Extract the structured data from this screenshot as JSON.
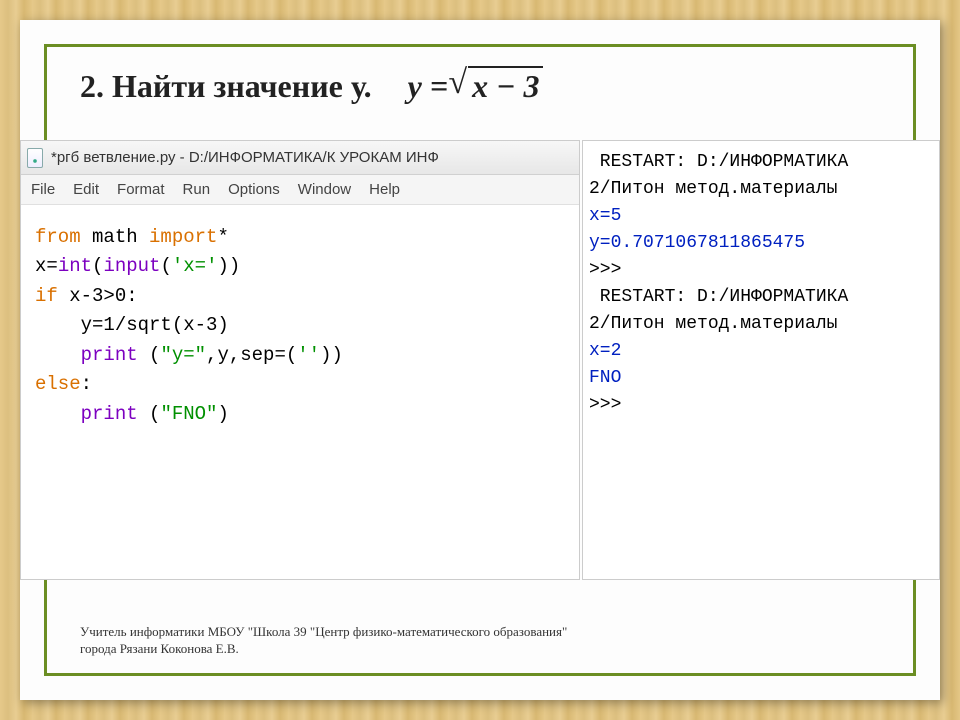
{
  "heading": {
    "number": "2.",
    "text": "Найти значение у.",
    "formula_lhs": "y  =",
    "formula_root": "x − 3"
  },
  "ide": {
    "title": "*ргб ветвление.ру - D:/ИНФОРМАТИКА/К УРОКАМ ИНФ",
    "menu": [
      "File",
      "Edit",
      "Format",
      "Run",
      "Options",
      "Window",
      "Help"
    ],
    "code": {
      "l1_from": "from",
      "l1_math": "math",
      "l1_import": "import",
      "l1_star": "*",
      "l2_a": "x=",
      "l2_b": "int",
      "l2_c": "(",
      "l2_d": "input",
      "l2_e": "(",
      "l2_f": "'x='",
      "l2_g": "))",
      "l3_a": "if",
      "l3_b": " x-3>0:",
      "l4": "    y=1/sqrt(x-3)",
      "l5_a": "    ",
      "l5_b": "print",
      "l5_c": " (",
      "l5_d": "\"y=\"",
      "l5_e": ",y,sep=(",
      "l5_f": "''",
      "l5_g": "))",
      "l6_a": "else",
      "l6_b": ":",
      "l7_a": "    ",
      "l7_b": "print",
      "l7_c": " (",
      "l7_d": "\"FNO\"",
      "l7_e": ")"
    }
  },
  "shell": {
    "r1": " RESTART: D:/ИНФОРМАТИКА",
    "r2": "2/Питон метод.материалы",
    "x1": "x=5",
    "y1": "y=0.7071067811865475",
    "p1": ">>>",
    "r3": " RESTART: D:/ИНФОРМАТИКА",
    "r4": "2/Питон метод.материалы",
    "x2": "x=2",
    "fno": "FNO",
    "p2": ">>>"
  },
  "footer": {
    "line1": "Учитель информатики МБОУ \"Школа 39 \"Центр физико-математического образования\"",
    "line2": "города Рязани Коконова Е.В."
  }
}
